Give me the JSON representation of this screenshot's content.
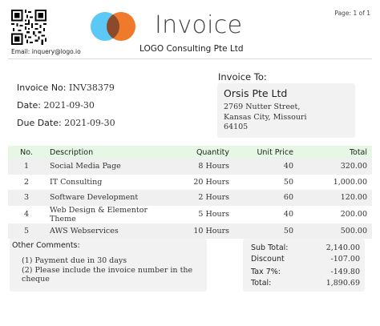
{
  "header": {
    "email": "Email: inquery@logo.io",
    "title": "Invoice",
    "company": "LOGO Consulting Pte Ltd",
    "page": "Page: 1 of 1"
  },
  "colors": {
    "logo_blue": "#5bc8f5",
    "logo_orange": "#f07a2b",
    "logo_overlap": "#8b4a2b",
    "table_header_bg": "#e6f7e6",
    "panel_bg": "#f2f2f2"
  },
  "meta": {
    "invoice_no_label": "Invoice No:",
    "invoice_no": "INV38379",
    "date_label": "Date:",
    "date": "2021-09-30",
    "due_label": "Due Date:",
    "due": "2021-09-30"
  },
  "invoice_to": {
    "label": "Invoice To:",
    "name": "Orsis Pte Ltd",
    "address_1": "2769 Nutter Street,",
    "address_2": "Kansas City, Missouri",
    "address_3": "64105"
  },
  "table": {
    "headers": [
      "No.",
      "Description",
      "Quantity",
      "Unit Price",
      "Total"
    ],
    "rows": [
      [
        "1",
        "Social Media Page",
        "8 Hours",
        "40",
        "320.00"
      ],
      [
        "2",
        "IT Consulting",
        "20 Hours",
        "50",
        "1,000.00"
      ],
      [
        "3",
        "Software Development",
        "2 Hours",
        "60",
        "120.00"
      ],
      [
        "4",
        "Web Design & Elementor Theme",
        "5 Hours",
        "40",
        "200.00"
      ],
      [
        "5",
        "AWS Webservices",
        "10 Hours",
        "50",
        "500.00"
      ]
    ]
  },
  "comments": {
    "label": "Other Comments:",
    "line_1": "(1) Payment due in 30 days",
    "line_2": "(2) Please include the invoice number in the cheque"
  },
  "totals": {
    "subtotal_label": "Sub Total:",
    "subtotal": "2,140.00",
    "discount_label": "Discount",
    "discount": "-107.00",
    "tax_label": "Tax 7%:",
    "tax": "-149.80",
    "total_label": "Total:",
    "total": "1,890.69"
  }
}
